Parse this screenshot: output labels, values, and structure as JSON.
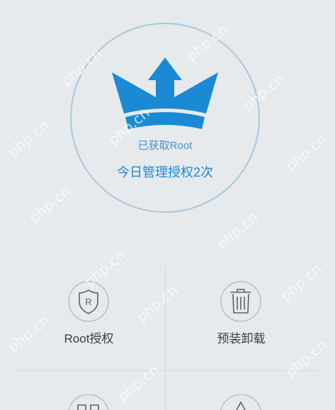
{
  "colors": {
    "background": "#e6eaec",
    "accent": "#1a8ad4",
    "ring": "#a9c7dd",
    "status_text": "#4a92cf",
    "label": "#3d3d3d",
    "divider": "#d3d8db",
    "icon": "#5d6266",
    "icon_ring": "#b8bfc3",
    "watermark": "#ffffff"
  },
  "header": {
    "logo_icon": "crown-icon",
    "root_status": "已获取Root",
    "auth_summary": "今日管理授权2次"
  },
  "grid": {
    "items": [
      {
        "label": "Root授权",
        "icon": "shield-r-icon",
        "icon_letter": "R"
      },
      {
        "label": "预装卸载",
        "icon": "trash-icon"
      },
      {
        "icon": "apps-grid-icon"
      },
      {
        "icon": "star-icon"
      }
    ]
  },
  "watermark": {
    "text": "php.cn"
  }
}
